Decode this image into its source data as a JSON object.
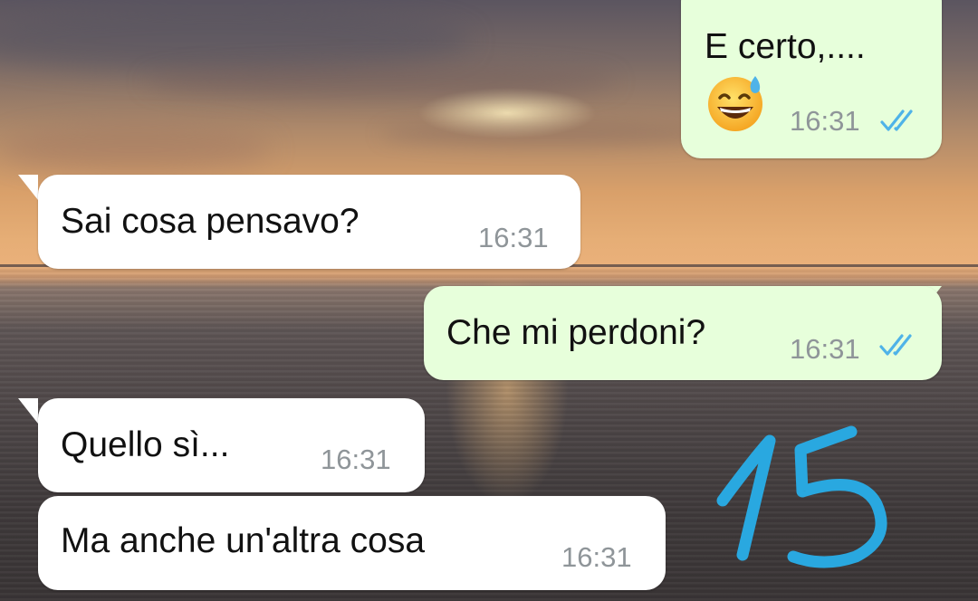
{
  "messages": [
    {
      "direction": "outgoing",
      "text": "E certo,....",
      "emoji": "grinning-face-with-sweat",
      "time": "16:31",
      "status": "read"
    },
    {
      "direction": "incoming",
      "text": "Sai cosa pensavo?",
      "time": "16:31"
    },
    {
      "direction": "outgoing",
      "text": "Che mi perdoni?",
      "time": "16:31",
      "status": "read"
    },
    {
      "direction": "incoming",
      "text": "Quello sì...",
      "time": "16:31"
    },
    {
      "direction": "incoming",
      "text": "Ma anche un'altra cosa",
      "time": "16:31"
    }
  ],
  "annotation": {
    "text": "15",
    "color": "#29a8e0"
  },
  "colors": {
    "outgoing_bubble": "#e7ffdb",
    "incoming_bubble": "#ffffff",
    "read_ticks": "#4fb3e8",
    "timestamp": "#8f9599"
  }
}
